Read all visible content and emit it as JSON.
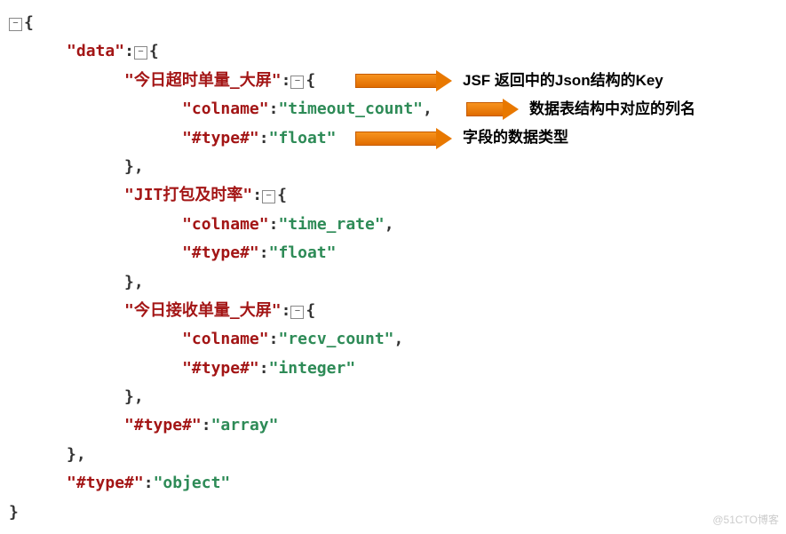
{
  "json": {
    "root_open": "{",
    "data_key": "\"data\"",
    "data_open": "{",
    "key1": "\"今日超时单量_大屏\"",
    "key1_open": "{",
    "colname_key": "\"colname\"",
    "colname1_val": "\"timeout_count\"",
    "type_key": "\"#type#\"",
    "type1_val": "\"float\"",
    "close_brace_comma": "},",
    "key2": "\"JIT打包及时率\"",
    "key2_open": "{",
    "colname2_val": "\"time_rate\"",
    "type2_val": "\"float\"",
    "key3": "\"今日接收单量_大屏\"",
    "key3_open": "{",
    "colname3_val": "\"recv_count\"",
    "type3_val": "\"integer\"",
    "data_type_val": "\"array\"",
    "root_type_val": "\"object\"",
    "close_brace": "}",
    "colon": ":",
    "comma": ",",
    "toggle_glyph": "−"
  },
  "annotations": {
    "a1": "JSF 返回中的Json结构的Key",
    "a2": "数据表结构中对应的列名",
    "a3": "字段的数据类型"
  },
  "watermark": "@51CTO博客"
}
